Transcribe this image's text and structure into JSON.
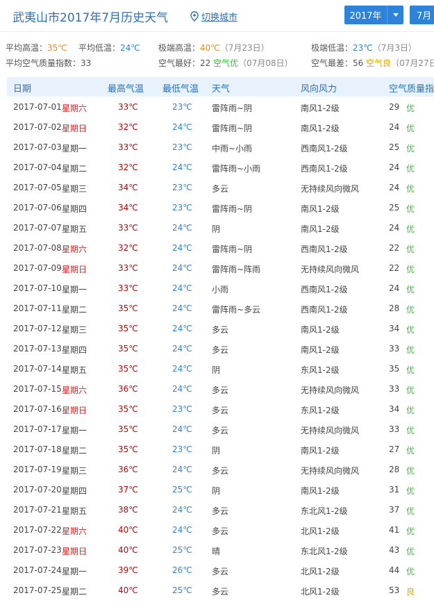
{
  "header": {
    "title": "武夷山市2017年7月历史天气",
    "switch_city": "切换城市",
    "year": "2017年",
    "month": "7月"
  },
  "summary": {
    "avg_high_label": "平均高温：",
    "avg_high": "35℃",
    "avg_low_label": "平均低温：",
    "avg_low": "24℃",
    "max_high_label": "极端高温：",
    "max_high": "40℃",
    "max_high_date": "（7月23日）",
    "min_low_label": "极端低温：",
    "min_low": "23℃",
    "min_low_date": "（7月3日）",
    "aqi_avg_label": "平均空气质量指数：",
    "aqi_avg": "33",
    "best_label": "空气最好：",
    "best_val": "22",
    "best_level": "空气优",
    "best_date": "（07月08日）",
    "worst_label": "空气最差：",
    "worst_val": "56",
    "worst_level": "空气良",
    "worst_date": "（07月27日"
  },
  "table": {
    "headers": {
      "date": "日期",
      "max": "最高气温",
      "min": "最低气温",
      "weather": "天气",
      "wind": "风向风力",
      "aqi": "空气质量指"
    },
    "rows": [
      {
        "date": "2017-07-01",
        "week": "星期六",
        "weekend": true,
        "max": "33℃",
        "min": "23℃",
        "weather": "雷阵雨~阴",
        "wind": "南风1-2级",
        "aqi": "29",
        "level": "优"
      },
      {
        "date": "2017-07-02",
        "week": "星期日",
        "weekend": true,
        "max": "32℃",
        "min": "24℃",
        "weather": "雷阵雨~阴",
        "wind": "南风1-2级",
        "aqi": "24",
        "level": "优"
      },
      {
        "date": "2017-07-03",
        "week": "星期一",
        "weekend": false,
        "max": "33℃",
        "min": "23℃",
        "weather": "中雨~小雨",
        "wind": "西南风1-2级",
        "aqi": "25",
        "level": "优"
      },
      {
        "date": "2017-07-04",
        "week": "星期二",
        "weekend": false,
        "max": "32℃",
        "min": "24℃",
        "weather": "雷阵雨~小雨",
        "wind": "西南风1-2级",
        "aqi": "24",
        "level": "优"
      },
      {
        "date": "2017-07-05",
        "week": "星期三",
        "weekend": false,
        "max": "34℃",
        "min": "23℃",
        "weather": "多云",
        "wind": "无持续风向微风",
        "aqi": "24",
        "level": "优"
      },
      {
        "date": "2017-07-06",
        "week": "星期四",
        "weekend": false,
        "max": "34℃",
        "min": "23℃",
        "weather": "雷阵雨~阴",
        "wind": "南风1-2级",
        "aqi": "25",
        "level": "优"
      },
      {
        "date": "2017-07-07",
        "week": "星期五",
        "weekend": false,
        "max": "33℃",
        "min": "24℃",
        "weather": "阴",
        "wind": "南风1-2级",
        "aqi": "24",
        "level": "优"
      },
      {
        "date": "2017-07-08",
        "week": "星期六",
        "weekend": true,
        "max": "32℃",
        "min": "24℃",
        "weather": "雷阵雨~阴",
        "wind": "西南风1-2级",
        "aqi": "22",
        "level": "优"
      },
      {
        "date": "2017-07-09",
        "week": "星期日",
        "weekend": true,
        "max": "33℃",
        "min": "24℃",
        "weather": "雷阵雨~阵雨",
        "wind": "无持续风向微风",
        "aqi": "22",
        "level": "优"
      },
      {
        "date": "2017-07-10",
        "week": "星期一",
        "weekend": false,
        "max": "33℃",
        "min": "24℃",
        "weather": "小雨",
        "wind": "西南风1-2级",
        "aqi": "24",
        "level": "优"
      },
      {
        "date": "2017-07-11",
        "week": "星期二",
        "weekend": false,
        "max": "35℃",
        "min": "24℃",
        "weather": "雷阵雨~多云",
        "wind": "西南风1-2级",
        "aqi": "28",
        "level": "优"
      },
      {
        "date": "2017-07-12",
        "week": "星期三",
        "weekend": false,
        "max": "35℃",
        "min": "24℃",
        "weather": "多云",
        "wind": "南风1-2级",
        "aqi": "34",
        "level": "优"
      },
      {
        "date": "2017-07-13",
        "week": "星期四",
        "weekend": false,
        "max": "35℃",
        "min": "24℃",
        "weather": "多云",
        "wind": "南风1-2级",
        "aqi": "33",
        "level": "优"
      },
      {
        "date": "2017-07-14",
        "week": "星期五",
        "weekend": false,
        "max": "35℃",
        "min": "24℃",
        "weather": "阴",
        "wind": "东风1-2级",
        "aqi": "35",
        "level": "优"
      },
      {
        "date": "2017-07-15",
        "week": "星期六",
        "weekend": true,
        "max": "36℃",
        "min": "24℃",
        "weather": "多云",
        "wind": "无持续风向微风",
        "aqi": "33",
        "level": "优"
      },
      {
        "date": "2017-07-16",
        "week": "星期日",
        "weekend": true,
        "max": "35℃",
        "min": "23℃",
        "weather": "多云",
        "wind": "东风1-2级",
        "aqi": "34",
        "level": "优"
      },
      {
        "date": "2017-07-17",
        "week": "星期一",
        "weekend": false,
        "max": "35℃",
        "min": "24℃",
        "weather": "多云",
        "wind": "无持续风向微风",
        "aqi": "33",
        "level": "优"
      },
      {
        "date": "2017-07-18",
        "week": "星期二",
        "weekend": false,
        "max": "35℃",
        "min": "23℃",
        "weather": "阴",
        "wind": "南风1-2级",
        "aqi": "27",
        "level": "优"
      },
      {
        "date": "2017-07-19",
        "week": "星期三",
        "weekend": false,
        "max": "36℃",
        "min": "24℃",
        "weather": "多云",
        "wind": "无持续风向微风",
        "aqi": "28",
        "level": "优"
      },
      {
        "date": "2017-07-20",
        "week": "星期四",
        "weekend": false,
        "max": "37℃",
        "min": "25℃",
        "weather": "阴",
        "wind": "南风1-2级",
        "aqi": "31",
        "level": "优"
      },
      {
        "date": "2017-07-21",
        "week": "星期五",
        "weekend": false,
        "max": "38℃",
        "min": "24℃",
        "weather": "多云",
        "wind": "东北风1-2级",
        "aqi": "37",
        "level": "优"
      },
      {
        "date": "2017-07-22",
        "week": "星期六",
        "weekend": true,
        "max": "40℃",
        "min": "24℃",
        "weather": "多云",
        "wind": "北风1-2级",
        "aqi": "41",
        "level": "优"
      },
      {
        "date": "2017-07-23",
        "week": "星期日",
        "weekend": true,
        "max": "40℃",
        "min": "25℃",
        "weather": "晴",
        "wind": "东北风1-2级",
        "aqi": "43",
        "level": "优"
      },
      {
        "date": "2017-07-24",
        "week": "星期一",
        "weekend": false,
        "max": "39℃",
        "min": "26℃",
        "weather": "多云",
        "wind": "北风1-2级",
        "aqi": "44",
        "level": "优"
      },
      {
        "date": "2017-07-25",
        "week": "星期二",
        "weekend": false,
        "max": "40℃",
        "min": "25℃",
        "weather": "多云",
        "wind": "北风1-2级",
        "aqi": "53",
        "level": "良"
      }
    ]
  }
}
